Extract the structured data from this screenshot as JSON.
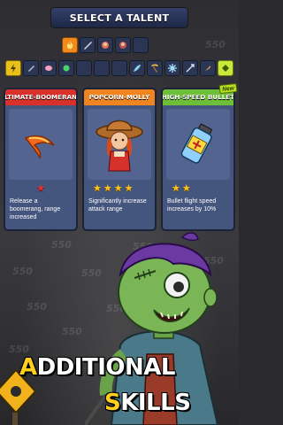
{
  "header": {
    "title": "SELECT A TALENT"
  },
  "talent_slots_row1": [
    {
      "icon": "flame-icon",
      "active": true
    },
    {
      "icon": "blade-icon",
      "active": false
    },
    {
      "icon": "hero-portrait-icon",
      "active": false
    },
    {
      "icon": "hero-portrait-icon",
      "active": false
    },
    {
      "icon": "empty-slot",
      "active": false
    }
  ],
  "talent_slots_row2_left": [
    "lightning-icon",
    "dagger-icon",
    "brain-icon",
    "green-orb-icon",
    "empty-slot",
    "empty-slot"
  ],
  "talent_slots_row2_right": [
    "empty-slot",
    "feather-icon",
    "pickaxe-icon",
    "snowflake-icon",
    "arrows-icon",
    "bullet-icon",
    "lime-gem-icon"
  ],
  "cards": [
    {
      "title": "ULTIMATE-BOOMERANG",
      "color": "#d8312c",
      "stars_filled": 1,
      "star_color": "red",
      "description": "Release a boomerang, range increased",
      "art": "boomerang"
    },
    {
      "title": "POPCORN-MOLLY",
      "color": "#f08421",
      "stars_filled": 4,
      "star_color": "gold",
      "description": "Significantly increase attack range",
      "art": "cowgirl"
    },
    {
      "title": "HIGH-SPEED BULLET",
      "color": "#6dbf3a",
      "stars_filled": 2,
      "star_color": "gold",
      "description": "Bullet flight speed increases by 10%",
      "art": "bullet-can",
      "badge": "New"
    }
  ],
  "background_numbers": [
    "550",
    "550",
    "550",
    "550",
    "550",
    "550",
    "550",
    "550",
    "550",
    "550"
  ],
  "headline": {
    "line1_first": "A",
    "line1_rest": "DDITIONAL",
    "line2_first": "S",
    "line2_rest": "KILLS"
  }
}
